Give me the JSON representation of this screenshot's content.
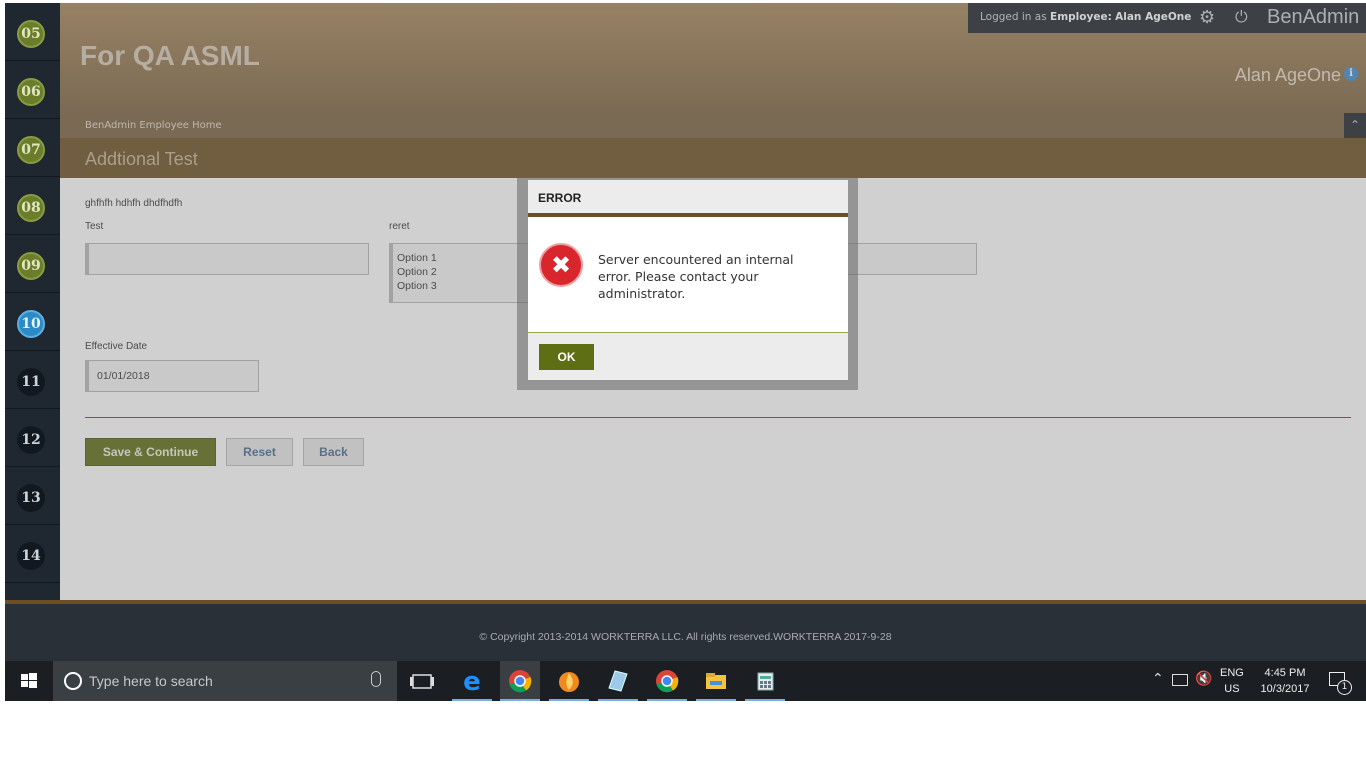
{
  "steps": [
    {
      "label": "05",
      "state": "done"
    },
    {
      "label": "06",
      "state": "done"
    },
    {
      "label": "07",
      "state": "done"
    },
    {
      "label": "08",
      "state": "done"
    },
    {
      "label": "09",
      "state": "done"
    },
    {
      "label": "10",
      "state": "current"
    },
    {
      "label": "11",
      "state": "todo"
    },
    {
      "label": "12",
      "state": "todo"
    },
    {
      "label": "13",
      "state": "todo"
    },
    {
      "label": "14",
      "state": "todo"
    }
  ],
  "header": {
    "app_title": "For QA ASML",
    "logged_in_prefix": "Logged in as",
    "logged_in_role": "Employee:",
    "logged_in_user": "Alan AgeOne",
    "brand": "BenAdmin",
    "user_display": "Alan AgeOne",
    "settings_icon": "gear-icon",
    "power_icon": "power-icon",
    "info_icon": "info-icon"
  },
  "breadcrumb": "BenAdmin Employee Home",
  "section_title": "Addtional Test",
  "form": {
    "intro_text": "ghfhfh hdhfh dhdfhdfh",
    "test_label": "Test",
    "test_value": "",
    "reret_label": "reret",
    "reret_options": [
      "Option 1",
      "Option 2",
      "Option 3"
    ],
    "effective_date_label": "Effective Date",
    "effective_date_value": "01/01/2018",
    "save_label": "Save & Continue",
    "reset_label": "Reset",
    "back_label": "Back"
  },
  "dialog": {
    "title": "ERROR",
    "message": "Server encountered an internal error. Please contact your administrator.",
    "ok_label": "OK",
    "icon": "error-icon"
  },
  "footer": {
    "copyright": "© Copyright 2013-2014 WORKTERRA LLC. All rights reserved.WORKTERRA 2017-9-28"
  },
  "taskbar": {
    "search_placeholder": "Type here to search",
    "lang_line1": "ENG",
    "lang_line2": "US",
    "time": "4:45 PM",
    "date": "10/3/2017",
    "notification_count": "1"
  },
  "colors": {
    "accent_brown": "#6e4f23",
    "button_green": "#5e6e15",
    "step_current": "#2a8bc7",
    "error_red": "#d8262c"
  }
}
